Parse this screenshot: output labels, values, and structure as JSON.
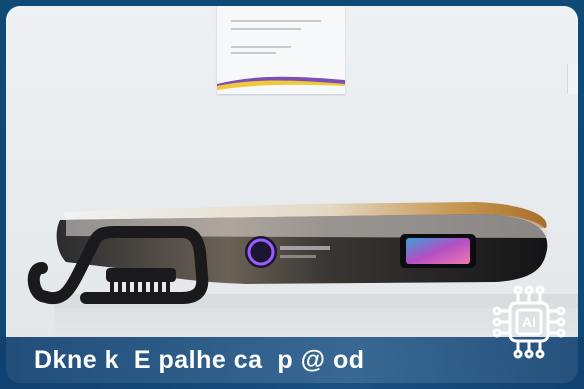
{
  "caption": "Dkne k  E palhe ca  p @ od",
  "badge": {
    "label": "AI",
    "icon": "ai-chip-icon"
  },
  "colors": {
    "frame": "#0f4a77",
    "caption_bar": "#124a7f",
    "badge": "#ffffff"
  },
  "image": {
    "subject": "photo"
  }
}
